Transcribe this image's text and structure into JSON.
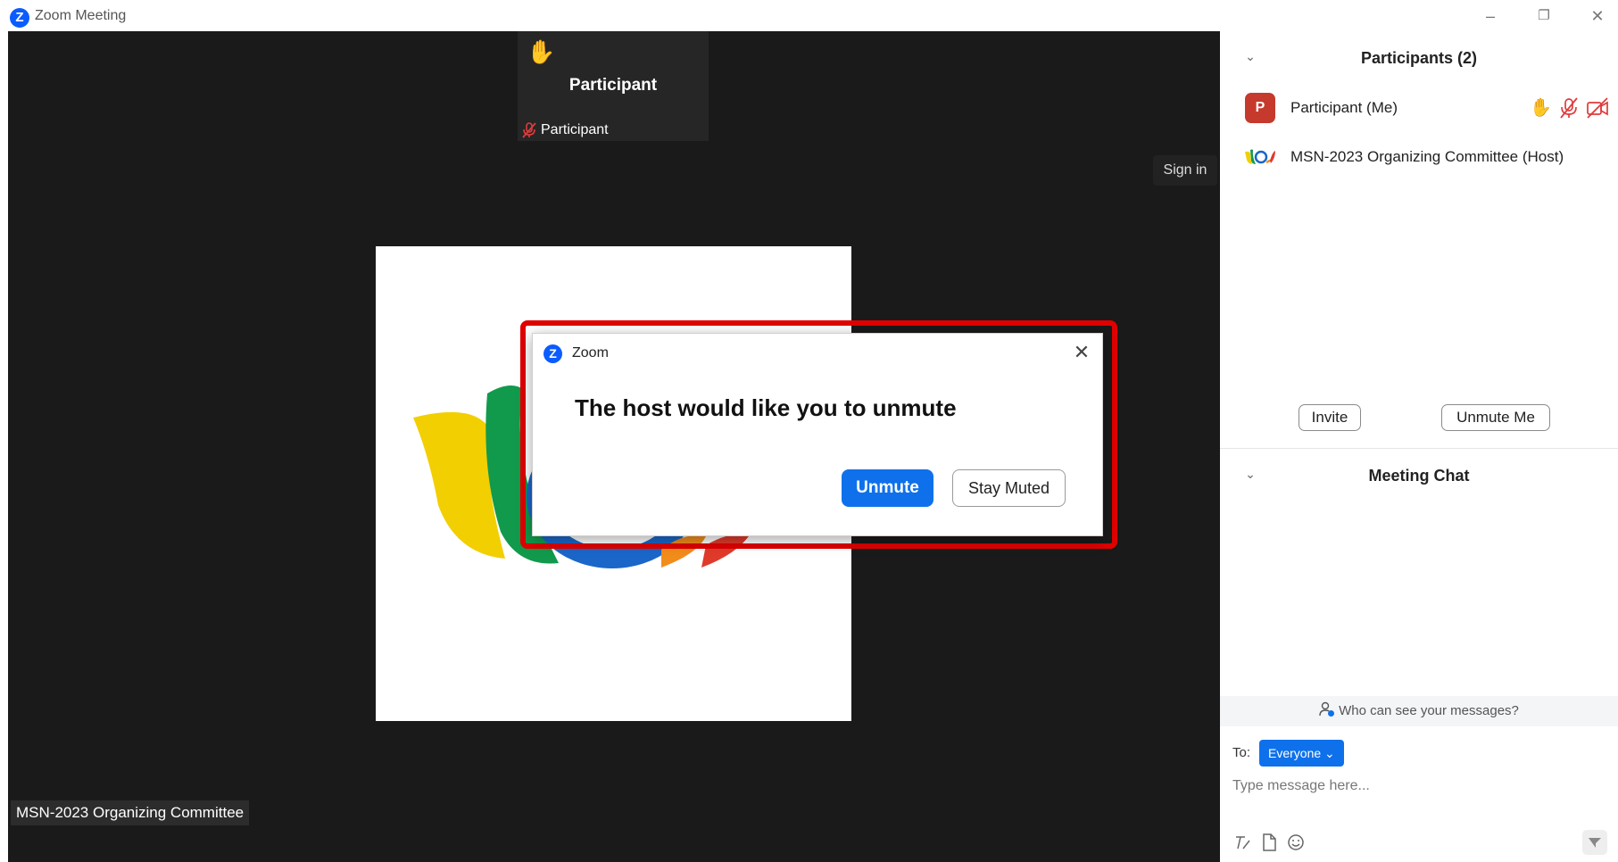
{
  "window": {
    "title": "Zoom Meeting",
    "app_logo_letter": "Z",
    "controls": {
      "minimize": "–",
      "restore": "❐",
      "close": "✕"
    }
  },
  "stage": {
    "tile": {
      "name": "Participant",
      "footer_name": "Participant",
      "hand_icon": "raised-hand-icon",
      "mic_icon": "muted-mic-icon"
    },
    "sign_in_label": "Sign in",
    "shared_content": "host-logo-image",
    "speaker_name_tag": "MSN-2023 Organizing Committee"
  },
  "dialog": {
    "logo_letter": "Z",
    "title": "Zoom",
    "close": "✕",
    "message": "The host would like you to unmute",
    "unmute_label": "Unmute",
    "stay_muted_label": "Stay Muted",
    "highlight_color": "#e10000"
  },
  "participants": {
    "heading": "Participants (2)",
    "list": [
      {
        "avatar": "P",
        "name": "Participant (Me)",
        "icons": [
          "raised-hand-icon",
          "muted-mic-icon",
          "video-off-icon"
        ]
      },
      {
        "avatar_icon": "organizer-logo-icon",
        "name": "MSN-2023 Organizing Committee (Host)"
      }
    ],
    "invite_label": "Invite",
    "unmute_me_label": "Unmute Me"
  },
  "chat": {
    "heading": "Meeting Chat",
    "who_can_see": "Who can see your messages?",
    "to_label": "To:",
    "recipient": "Everyone",
    "placeholder": "Type message here..."
  },
  "colors": {
    "accent": "#0e71eb",
    "brand": "#0b5cff",
    "stage": "#1a1a1a"
  }
}
